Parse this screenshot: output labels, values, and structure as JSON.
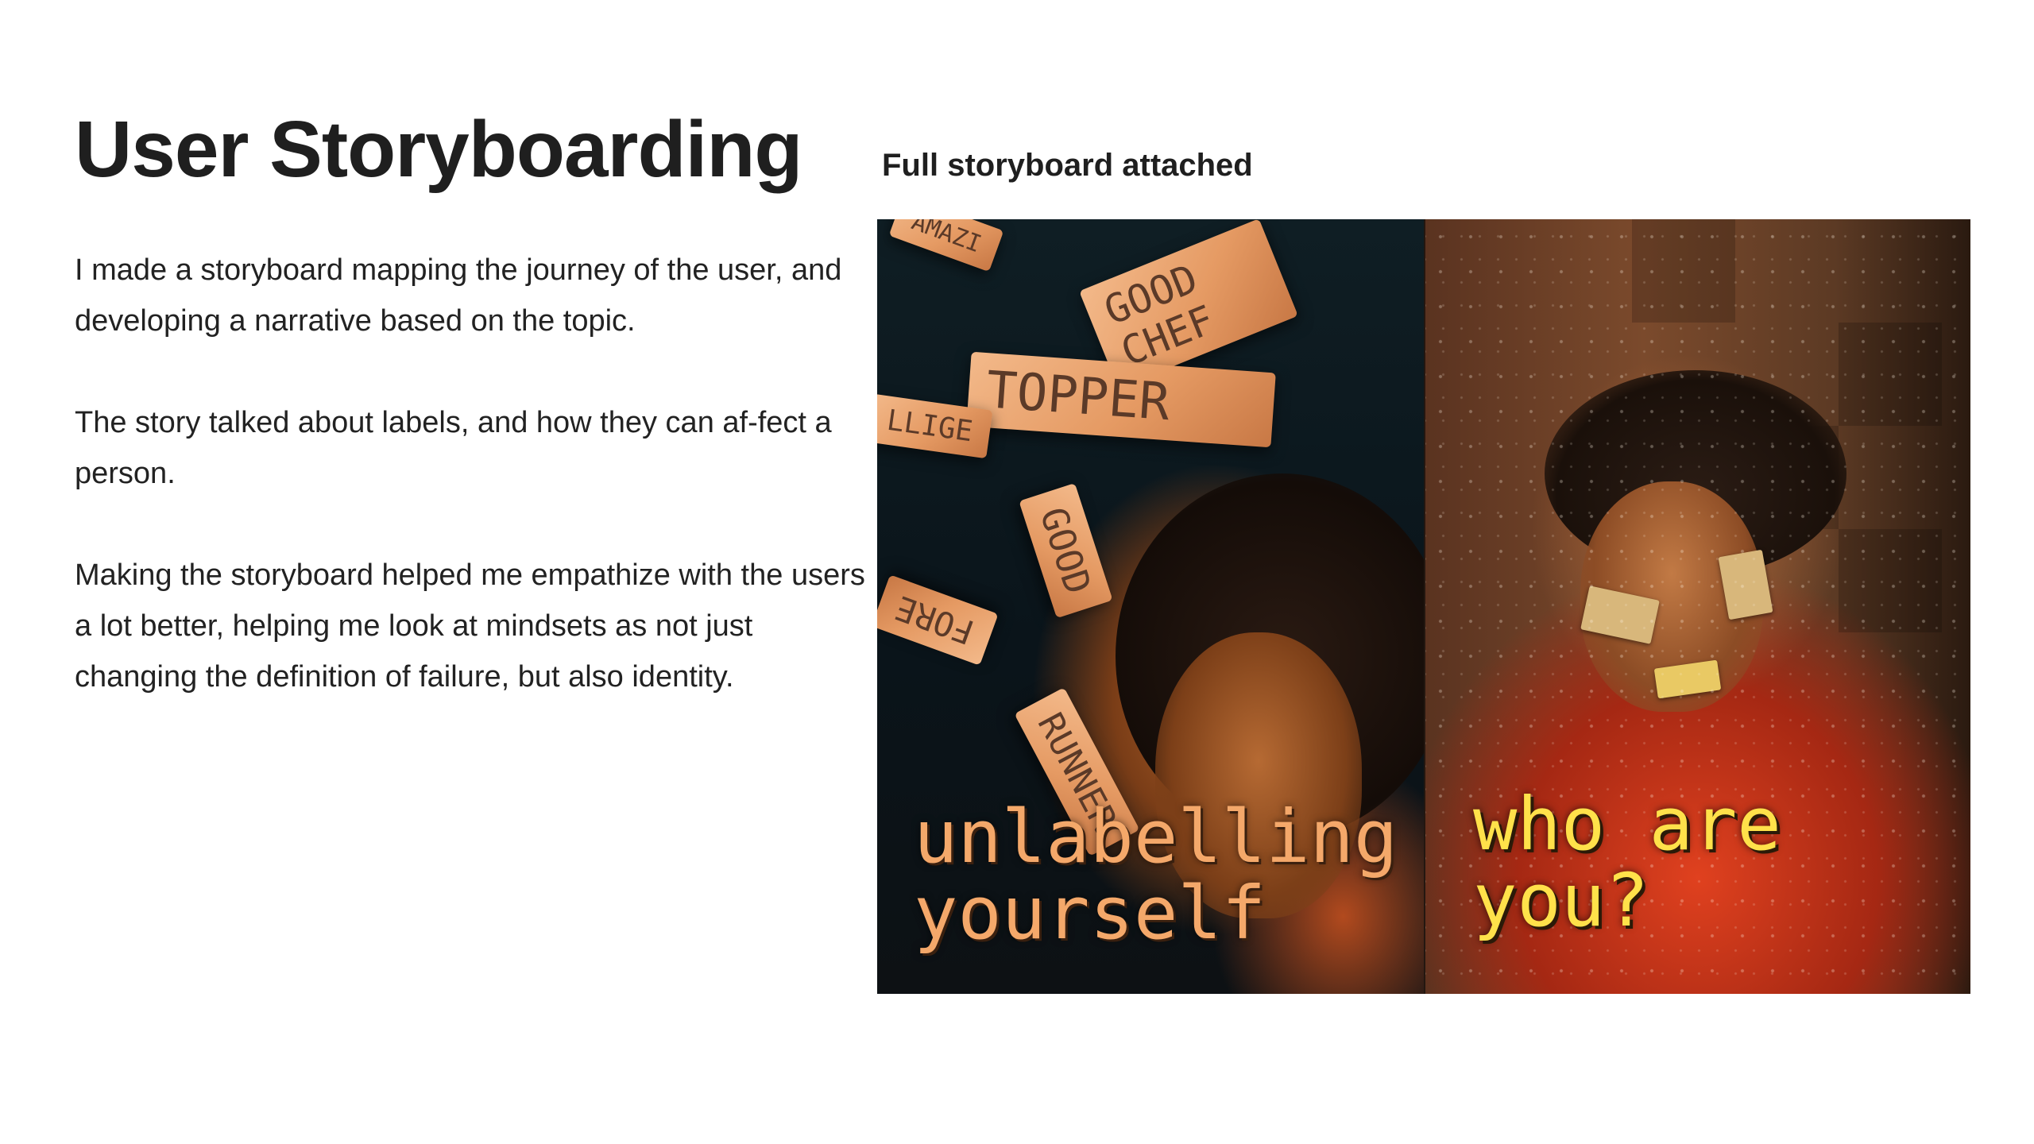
{
  "page": {
    "title": "User Storyboarding",
    "caption": "Full storyboard attached",
    "paragraphs": [
      "I made a storyboard mapping the journey of the user, and developing a narrative based on the topic.",
      "The story talked about labels, and how they can af-fect a person.",
      "Making the storyboard helped me empathize with the users a lot better, helping  me look at mindsets as not just changing the definition of failure, but also identity."
    ]
  },
  "storyboard": {
    "left_panel": {
      "overlay_line1": "unlabelling",
      "overlay_line2": "yourself",
      "labels": [
        "AMAZI",
        "GOOD CHEF",
        "TOPPER",
        "LLIGE",
        "GOOD",
        "FORE",
        "RUNNER"
      ]
    },
    "right_panel": {
      "overlay_line1": "who are",
      "overlay_line2": "you?"
    },
    "colors": {
      "left_overlay_text": "#f4a86a",
      "right_overlay_text": "#ffe14a"
    }
  }
}
